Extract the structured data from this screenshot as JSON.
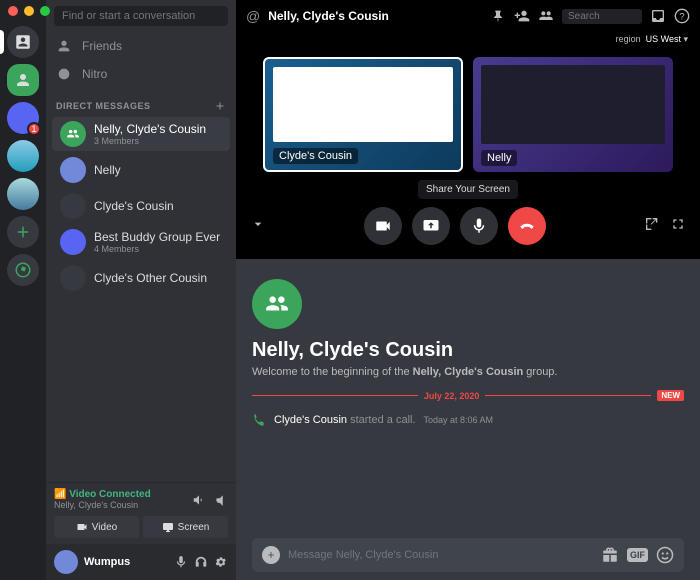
{
  "search_placeholder": "Find or start a conversation",
  "nav": {
    "friends": "Friends",
    "nitro": "Nitro"
  },
  "dm_header": "DIRECT MESSAGES",
  "dms": [
    {
      "name": "Nelly, Clyde's Cousin",
      "sub": "3 Members"
    },
    {
      "name": "Nelly",
      "sub": ""
    },
    {
      "name": "Clyde's Cousin",
      "sub": ""
    },
    {
      "name": "Best Buddy Group Ever",
      "sub": "4 Members"
    },
    {
      "name": "Clyde's Other Cousin",
      "sub": ""
    }
  ],
  "voice": {
    "status": "Video Connected",
    "channel": "Nelly, Clyde's Cousin",
    "video_btn": "Video",
    "screen_btn": "Screen"
  },
  "user": {
    "name": "Wumpus"
  },
  "header": {
    "title": "Nelly, Clyde's Cousin",
    "search": "Search",
    "region_label": "region",
    "region_value": "US West"
  },
  "call": {
    "participants": [
      "Clyde's Cousin",
      "Nelly"
    ],
    "tooltip": "Share Your Screen"
  },
  "welcome": {
    "title": "Nelly, Clyde's Cousin",
    "text_pre": "Welcome to the beginning of the ",
    "text_bold": "Nelly, Clyde's Cousin",
    "text_post": " group."
  },
  "divider": {
    "date": "July 22, 2020",
    "new": "NEW"
  },
  "message": {
    "who": "Clyde's Cousin",
    "action": " started a call.",
    "time": "Today at 8:06 AM"
  },
  "input_placeholder": "Message Nelly, Clyde's Cousin",
  "gif_label": "GIF",
  "badge_count": "1"
}
